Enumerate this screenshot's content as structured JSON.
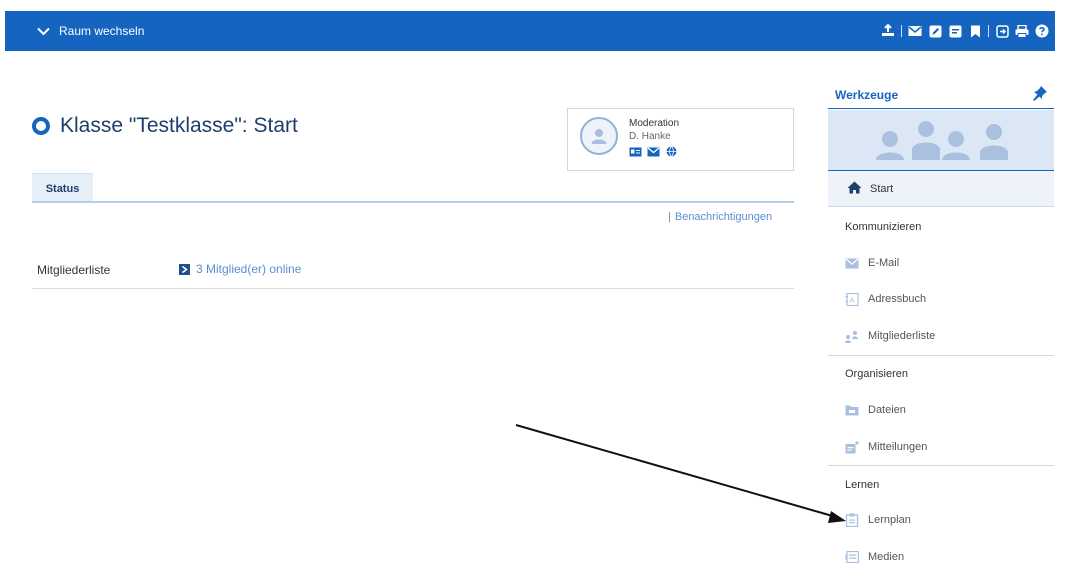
{
  "topbar": {
    "room_switch_label": "Raum wechseln",
    "bg_color": "#1565c0"
  },
  "page": {
    "title": "Klasse \"Testklasse\": Start"
  },
  "moderation": {
    "label": "Moderation",
    "name": "D. Hanke"
  },
  "tabs": [
    {
      "label": "Status",
      "active": true
    }
  ],
  "notifications": {
    "separator": "|",
    "label": "Benachrichtigungen"
  },
  "members": {
    "label": "Mitgliederliste",
    "online_text": "3 Mitglied(er) online"
  },
  "sidebar": {
    "title": "Werkzeuge",
    "start_label": "Start",
    "sections": [
      {
        "title": "Kommunizieren",
        "items": [
          {
            "label": "E-Mail",
            "icon": "mail-icon"
          },
          {
            "label": "Adressbuch",
            "icon": "address-book-icon"
          },
          {
            "label": "Mitgliederliste",
            "icon": "members-icon"
          }
        ]
      },
      {
        "title": "Organisieren",
        "items": [
          {
            "label": "Dateien",
            "icon": "files-icon"
          },
          {
            "label": "Mitteilungen",
            "icon": "announcements-icon"
          }
        ]
      },
      {
        "title": "Lernen",
        "items": [
          {
            "label": "Lernplan",
            "icon": "learning-plan-icon"
          },
          {
            "label": "Medien",
            "icon": "media-icon"
          }
        ]
      }
    ]
  },
  "colors": {
    "accent": "#1565c0",
    "link": "#5a8fd0",
    "title": "#1f3f6b"
  }
}
